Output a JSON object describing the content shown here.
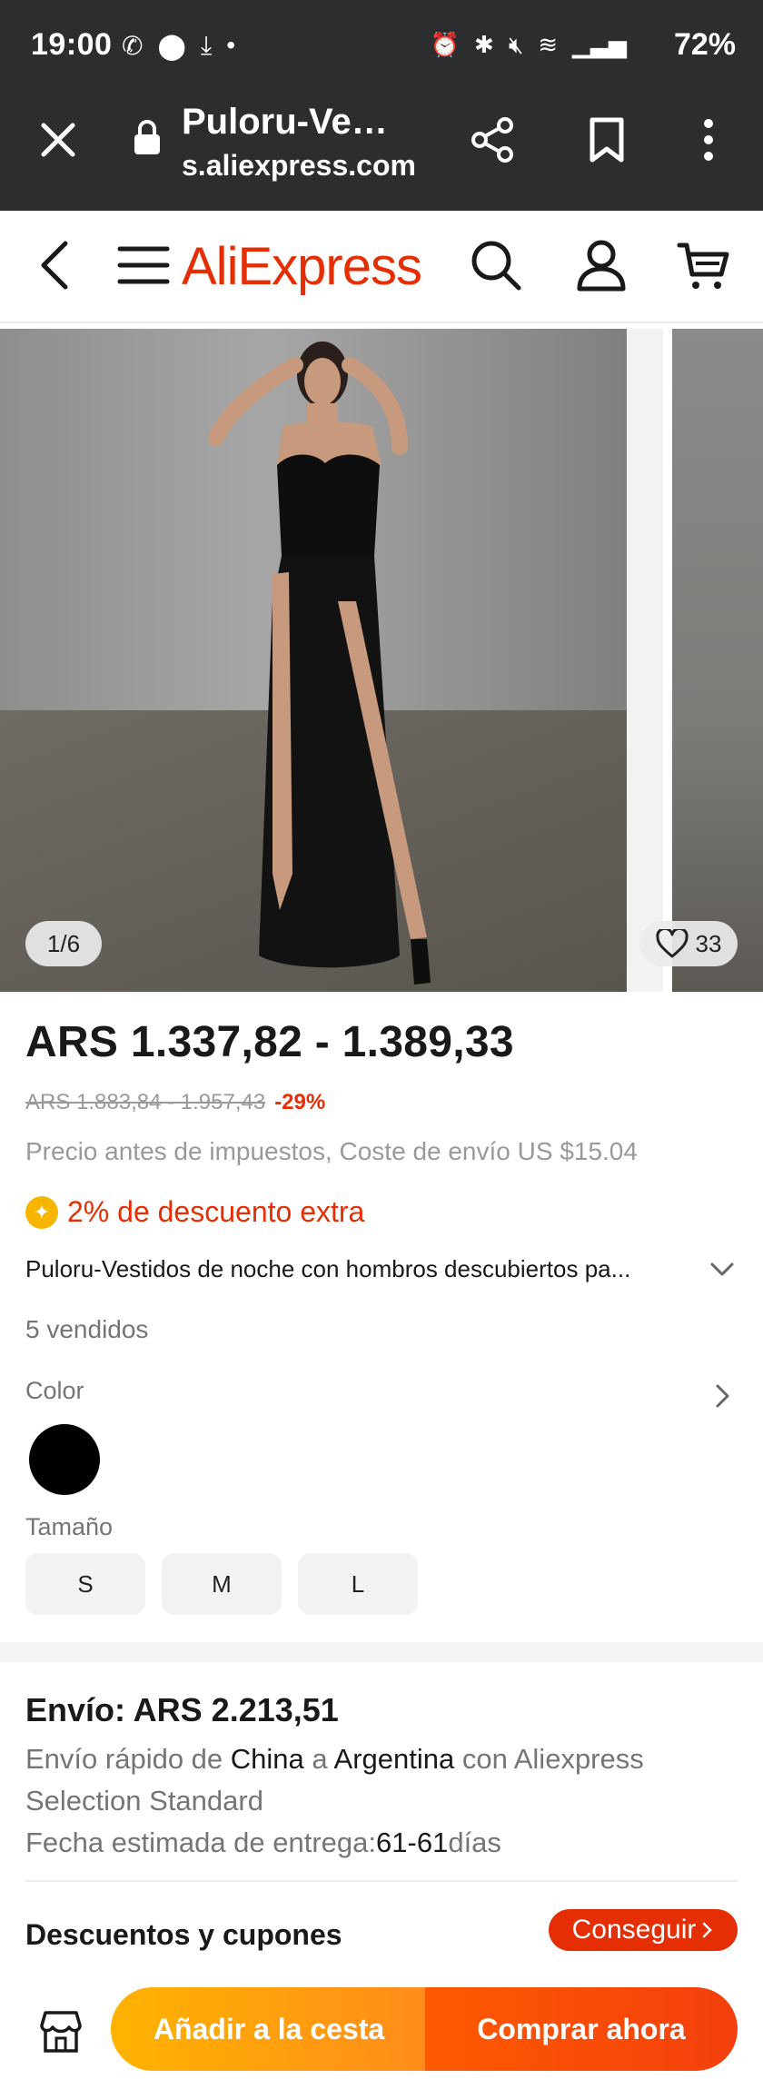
{
  "status_bar": {
    "time": "19:00",
    "battery": "72%",
    "left_icons": [
      "whatsapp-icon",
      "location-icon",
      "download-icon",
      "dot-icon"
    ],
    "right_icons": [
      "alarm-icon",
      "bluetooth-icon",
      "mute-icon",
      "wifi-icon",
      "signal-icon"
    ]
  },
  "browser": {
    "title": "Puloru-Ve…",
    "url": "s.aliexpress.com",
    "icons": [
      "close-icon",
      "lock-icon",
      "share-icon",
      "bookmark-icon",
      "more-icon"
    ]
  },
  "header": {
    "logo": "AliExpress",
    "icons": [
      "back-icon",
      "menu-icon",
      "search-icon",
      "account-icon",
      "cart-icon"
    ]
  },
  "gallery": {
    "pager": "1/6",
    "wishlist_count": "33"
  },
  "product": {
    "price": "ARS 1.337,82 - 1.389,33",
    "old_price": "ARS 1.883,84 - 1.957,43",
    "discount": "-29%",
    "tax_note": "Precio antes de impuestos, Coste de envío US $15.04",
    "extra_discount": "2% de descuento extra",
    "title": "Puloru-Vestidos de noche con hombros descubiertos pa...",
    "sold": "5 vendidos",
    "color_label": "Color",
    "size_label": "Tamaño",
    "sizes": [
      "S",
      "M",
      "L"
    ],
    "colors": {
      "swatch": "#000000",
      "accent": "#e62e04"
    }
  },
  "shipping": {
    "title": "Envío: ARS 2.213,51",
    "line_pre": "Envío rápido de ",
    "from": "China",
    "mid": " a ",
    "to": "Argentina",
    "line_post": " con Aliexpress Selection Standard",
    "eta_pre": "Fecha estimada de entrega:",
    "eta_days": "61-61",
    "eta_post": "días"
  },
  "coupons": {
    "label": "Descuentos y cupones",
    "button": "Conseguir"
  },
  "bottom_bar": {
    "add_to_cart": "Añadir a la cesta",
    "buy_now": "Comprar ahora"
  }
}
